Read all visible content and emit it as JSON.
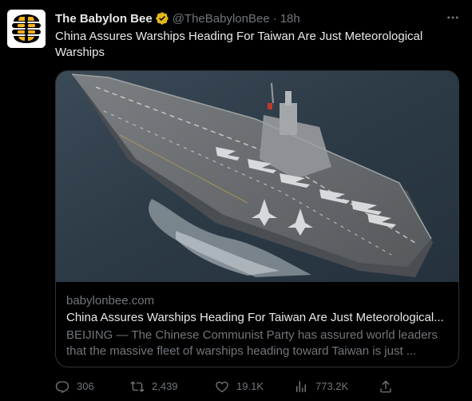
{
  "author": {
    "name": "The Babylon Bee",
    "handle": "@TheBabylonBee",
    "separator": "·",
    "time": "18h",
    "avatar_icon": "babylon-bee-logo",
    "verified_badge_color": "#e2b719"
  },
  "tweet": {
    "text": "China Assures Warships Heading For Taiwan Are Just Meteorological Warships"
  },
  "card": {
    "image_icon": "aircraft-carrier-photo",
    "domain": "babylonbee.com",
    "title": "China Assures Warships Heading For Taiwan Are Just Meteorological...",
    "description": "BEIJING — The Chinese Communist Party has assured world leaders that the massive fleet of warships heading toward Taiwan is just ..."
  },
  "actions": {
    "replies": "306",
    "reposts": "2,439",
    "likes": "19.1K",
    "views": "773.2K"
  },
  "colors": {
    "background": "#000000",
    "primary_text": "#e7e9ea",
    "secondary_text": "#71767b",
    "border": "#2f3336"
  }
}
